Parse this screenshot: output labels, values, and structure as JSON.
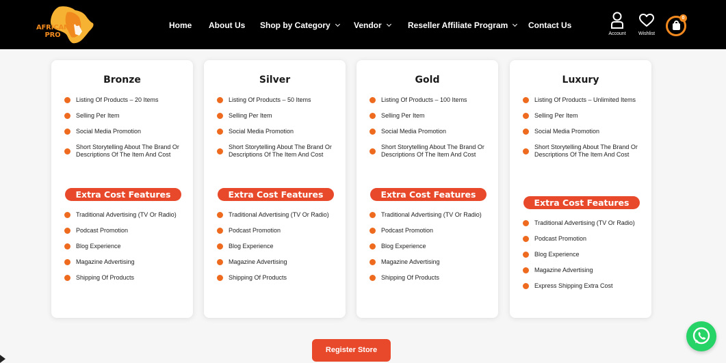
{
  "header": {
    "logo": {
      "line1": "AFRICAN",
      "line2": "PRO"
    },
    "nav": [
      {
        "label": "Home",
        "dropdown": false
      },
      {
        "label": "About Us",
        "dropdown": false
      },
      {
        "label": "Shop by Category",
        "dropdown": true
      },
      {
        "label": "Vendor",
        "dropdown": true
      },
      {
        "label": "Reseller Affiliate Program",
        "dropdown": true
      },
      {
        "label": "Contact Us",
        "dropdown": false
      }
    ],
    "account_label": "Account",
    "wishlist_label": "Wishlist",
    "cart_count": "0",
    "icons": {
      "account": "user-icon",
      "wishlist": "heart-icon",
      "cart": "shopping-bag-icon"
    }
  },
  "plans": [
    {
      "name": "Bronze",
      "features": [
        "Listing Of Products – 20 Items",
        "Selling Per Item",
        "Social Media Promotion",
        "Short Storytelling About The Brand Or Descriptions Of The Item And Cost"
      ],
      "extra_title": "Extra Cost Features",
      "extras": [
        "Traditional Advertising (TV Or Radio)",
        "Podcast Promotion",
        "Blog Experience",
        "Magazine Advertising",
        "Shipping Of Products"
      ]
    },
    {
      "name": "Silver",
      "features": [
        "Listing Of Products – 50 Items",
        "Selling Per Item",
        "Social Media Promotion",
        "Short Storytelling About The Brand Or Descriptions Of The Item And Cost"
      ],
      "extra_title": "Extra Cost Features",
      "extras": [
        "Traditional Advertising (TV Or Radio)",
        "Podcast Promotion",
        "Blog Experience",
        "Magazine Advertising",
        "Shipping Of Products"
      ]
    },
    {
      "name": "Gold",
      "features": [
        "Listing Of Products – 100 Items",
        "Selling Per Item",
        "Social Media Promotion",
        "Short Storytelling About The Brand Or Descriptions Of The Item And Cost"
      ],
      "extra_title": "Extra Cost Features",
      "extras": [
        "Traditional Advertising (TV Or Radio)",
        "Podcast Promotion",
        "Blog Experience",
        "Magazine Advertising",
        "Shipping Of Products"
      ]
    },
    {
      "name": "Luxury",
      "features": [
        "Listing Of Products – Unlimited Items",
        "Selling Per Item",
        "Social Media Promotion",
        "Short Storytelling About The Brand Or Descriptions Of The Item And Cost"
      ],
      "extra_title": "Extra Cost Features",
      "extras": [
        "Traditional Advertising (TV Or Radio)",
        "Podcast Promotion",
        "Blog Experience",
        "Magazine Advertising",
        "Express Shipping Extra Cost"
      ]
    }
  ],
  "register_label": "Register Store",
  "colors": {
    "header_bg": "#000000",
    "accent": "#e8492b",
    "bullet": "#ee6a1e",
    "logo_orange": "#f28a1f",
    "whatsapp": "#25d366"
  }
}
